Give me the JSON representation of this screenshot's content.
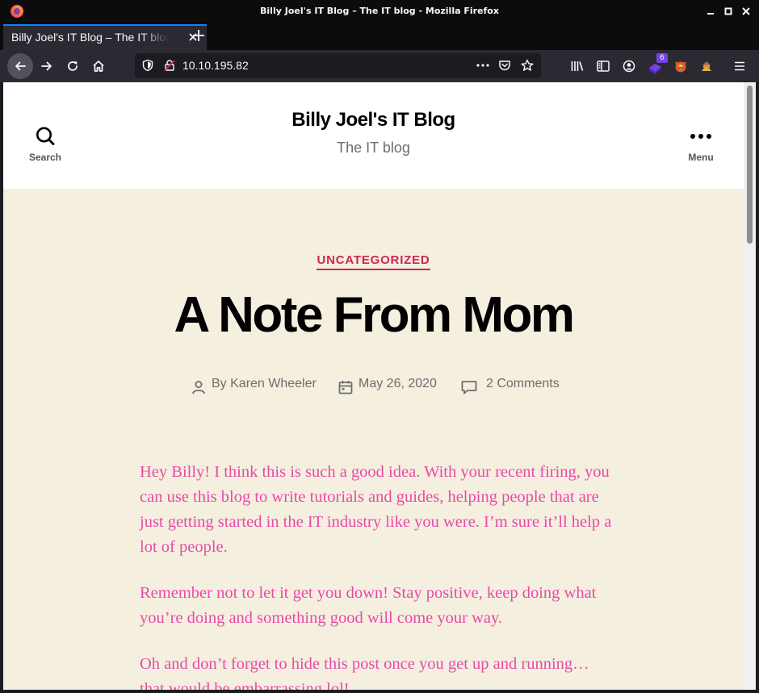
{
  "window": {
    "title": "Billy Joel's IT Blog – The IT blog - Mozilla Firefox"
  },
  "tab": {
    "label": "Billy Joel's IT Blog – The IT blog"
  },
  "toolbar": {
    "url": "10.10.195.82",
    "extension_badge": "6"
  },
  "site": {
    "title": "Billy Joel's IT Blog",
    "description": "The IT blog",
    "search_label": "Search",
    "menu_label": "Menu"
  },
  "post": {
    "category": "UNCATEGORIZED",
    "title": "A Note From Mom",
    "author": "By Karen Wheeler",
    "date": "May 26, 2020",
    "comments": "2 Comments",
    "paragraphs": [
      "Hey Billy!  I think this is such a good idea.  With your recent firing, you can use this blog to write tutorials and guides, helping people that are just getting started in the IT industry like you were.  I’m sure it’ll help a lot of people.",
      "Remember not to let it get you down!  Stay positive, keep doing what you’re doing and something good will come your way.",
      "Oh and don’t forget to hide this post once you get up and running… that would be embarrassing lol!"
    ]
  },
  "colors": {
    "accent": "#cd2653",
    "page_bg": "#f5efe0",
    "body_text": "#e94aa6",
    "browser_chrome": "#2b2a33"
  }
}
